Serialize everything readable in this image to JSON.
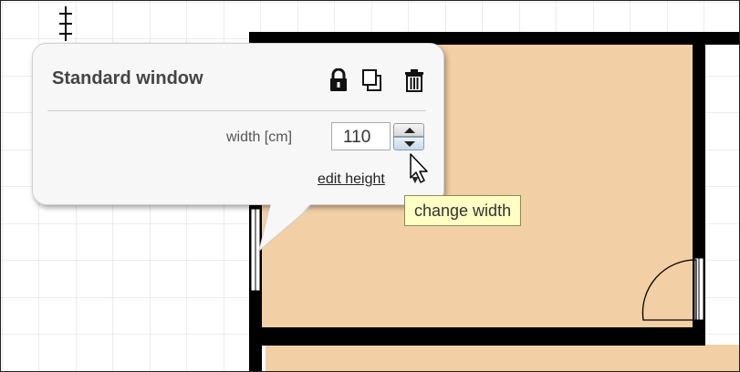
{
  "popup": {
    "title": "Standard window",
    "icons": [
      "lock-icon",
      "copy-icon",
      "trash-icon"
    ],
    "width_label": "width [cm]",
    "width_value": "110",
    "edit_height_label": "edit height",
    "edit_height_arrow": "▼"
  },
  "tooltip": {
    "text": "change width"
  },
  "colors": {
    "floor": "#f2cfa5",
    "wall": "#000000",
    "grid_line": "#d8d8d8",
    "popup_bg": "#f7f7f7",
    "tooltip_bg": "#ffffc4"
  }
}
